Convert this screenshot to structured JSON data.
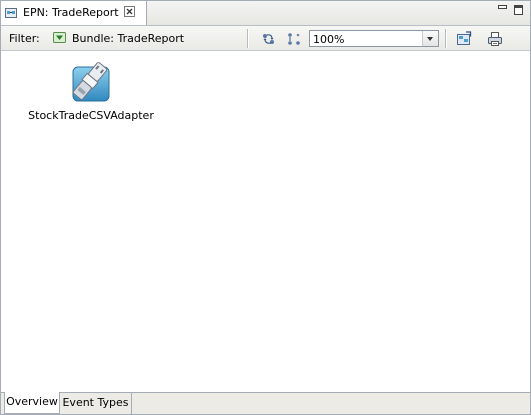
{
  "editor": {
    "tab_title": "EPN: TradeReport",
    "tab_icon": "epn-editor-icon",
    "close_icon": "close-icon"
  },
  "toolbar": {
    "filter_label": "Filter:",
    "bundle_label": "Bundle: TradeReport",
    "zoom_value": "100%",
    "icons": [
      "auto-layout-icon",
      "arrange-icon",
      "export-image-icon",
      "print-icon"
    ]
  },
  "canvas": {
    "nodes": [
      {
        "label": "StockTradeCSVAdapter",
        "icon": "adapter-icon"
      }
    ]
  },
  "bottom_tabs": [
    {
      "label": "Overview",
      "active": true
    },
    {
      "label": "Event Types",
      "active": false
    }
  ],
  "colors": {
    "accent": "#4a9fd0",
    "border": "#a5acb5"
  }
}
